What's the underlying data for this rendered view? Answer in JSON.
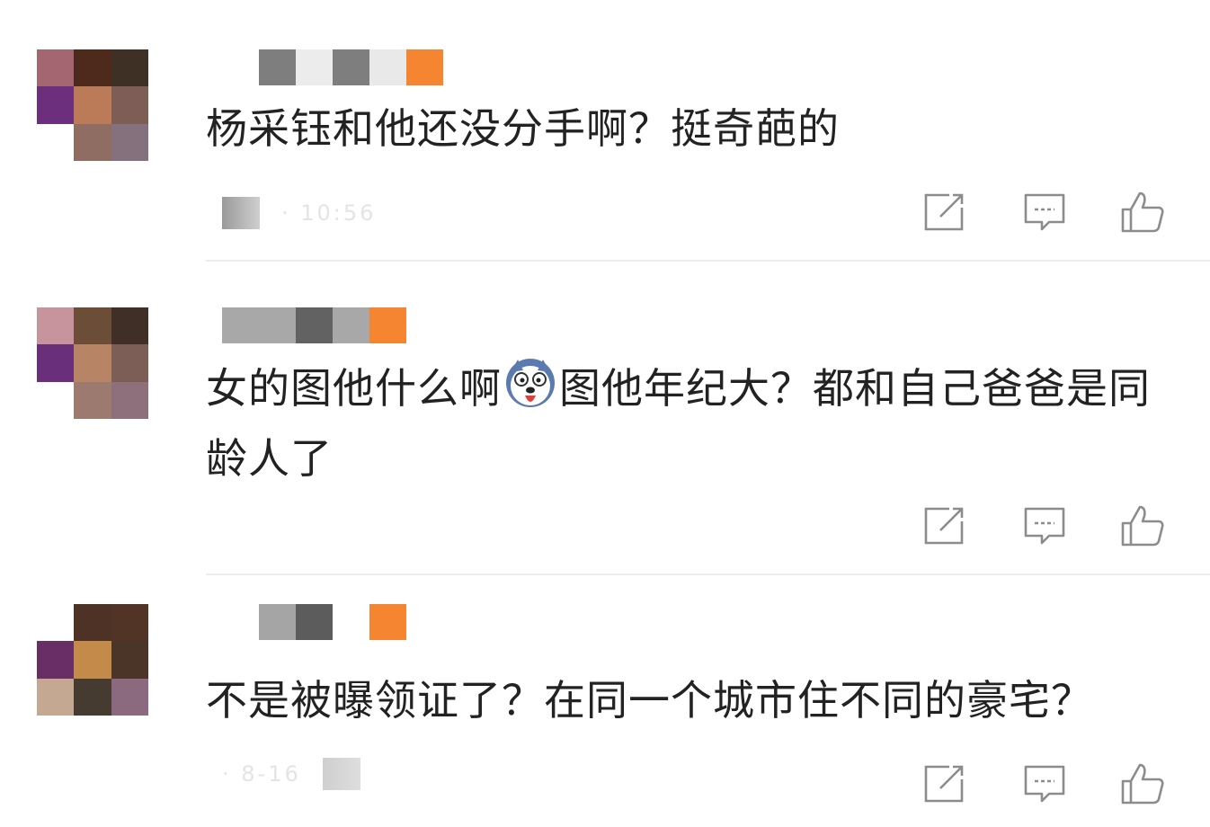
{
  "comments": [
    {
      "text": "杨采钰和他还没分手啊？挺奇葩的",
      "time": "· 10:56",
      "avatar_colors": [
        "#a46670",
        "#4e2a1c",
        "#3f3026",
        "#6c2f7e",
        "#bb7b58",
        "#7d5d55",
        "#ffffff",
        "#8f6d62",
        "#85717e"
      ],
      "name_blocks": [
        "#ffffff",
        "#7e7e7e",
        "#ececec",
        "#7e7e7e",
        "#e9e9e9",
        "#f58530"
      ]
    },
    {
      "text_before_emoji": "女的图他什么啊",
      "emoji": "husky-emoji",
      "text_after_emoji": "图他年纪大？都和自己爸爸是同龄人了",
      "avatar_colors": [
        "#c7949e",
        "#6c4d37",
        "#3f2f26",
        "#6a2f7a",
        "#b78565",
        "#7c5e56",
        "#ffffff",
        "#9d7a70",
        "#8e6f7c"
      ],
      "name_blocks": [
        "#a8a8a8",
        "#a8a8a8",
        "#626262",
        "#a8a8a8",
        "#f58530"
      ]
    },
    {
      "text": "不是被曝领证了？在同一个城市住不同的豪宅？",
      "time": "· 8-16",
      "avatar_colors": [
        "#ffffff",
        "#4f3226",
        "#513426",
        "#6a2e66",
        "#c48a4a",
        "#4b3528",
        "#c4a891",
        "#453b30",
        "#8b6a80"
      ],
      "name_blocks": [
        "#ffffff",
        "#a5a5a5",
        "#5c5c5c",
        "#ffffff",
        "#f58530"
      ]
    }
  ],
  "actions": {
    "share_icon": "share-edit-icon",
    "comment_icon": "comment-bubble-icon",
    "like_icon": "thumbs-up-icon"
  },
  "colors": {
    "text": "#222222",
    "icon": "#8c8c8c",
    "divider": "#ececec",
    "badge": "#f58530"
  }
}
